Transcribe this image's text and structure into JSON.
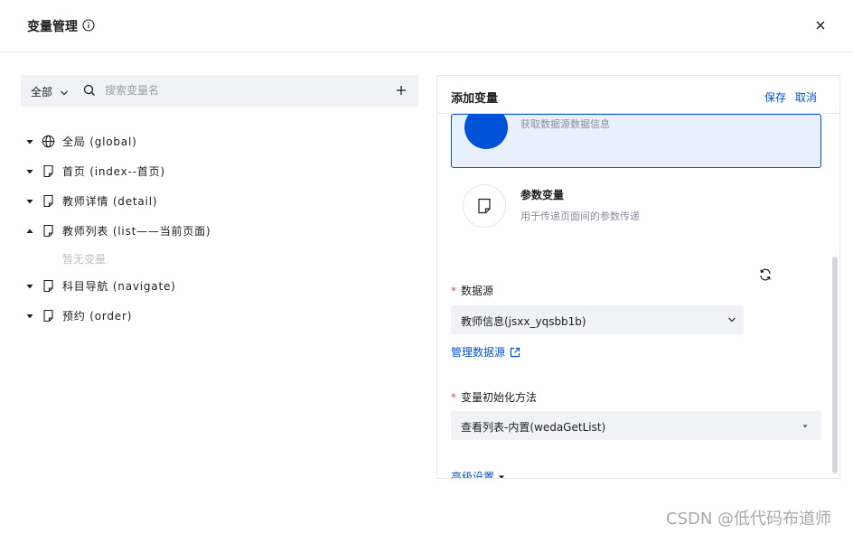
{
  "dialog": {
    "title": "变量管理",
    "close_icon": "close-icon",
    "info_icon": "info-icon"
  },
  "left": {
    "scope_label": "全部",
    "search_placeholder": "搜索变量名",
    "tree": [
      {
        "label": "全局 (global)",
        "icon": "globe-icon",
        "expanded": false
      },
      {
        "label": "首页 (index--首页)",
        "icon": "page-icon",
        "expanded": false
      },
      {
        "label": "教师详情 (detail)",
        "icon": "page-icon",
        "expanded": false
      },
      {
        "label": "教师列表 (list——当前页面)",
        "icon": "page-icon",
        "expanded": true
      },
      {
        "label": "科目导航 (navigate)",
        "icon": "page-icon",
        "expanded": false
      },
      {
        "label": "预约 (order)",
        "icon": "page-icon",
        "expanded": false
      }
    ],
    "empty_text": "暂无变量"
  },
  "right": {
    "title": "添加变量",
    "save_label": "保存",
    "cancel_label": "取消",
    "card_selected_desc": "获取数据源数据信息",
    "card_param": {
      "name": "参数变量",
      "desc": "用于传递页面间的参数传递"
    },
    "datasource": {
      "label": "数据源",
      "value": "教师信息(jsxx_yqsbb1b)",
      "manage_link": "管理数据源"
    },
    "init_method": {
      "label": "变量初始化方法",
      "value": "查看列表-内置(wedaGetList)"
    },
    "advanced_label": "高级设置"
  },
  "watermark": "CSDN @低代码布道师",
  "colors": {
    "accent": "#0052d9",
    "required": "#e34d59",
    "field_bg": "#f1f2f5"
  }
}
